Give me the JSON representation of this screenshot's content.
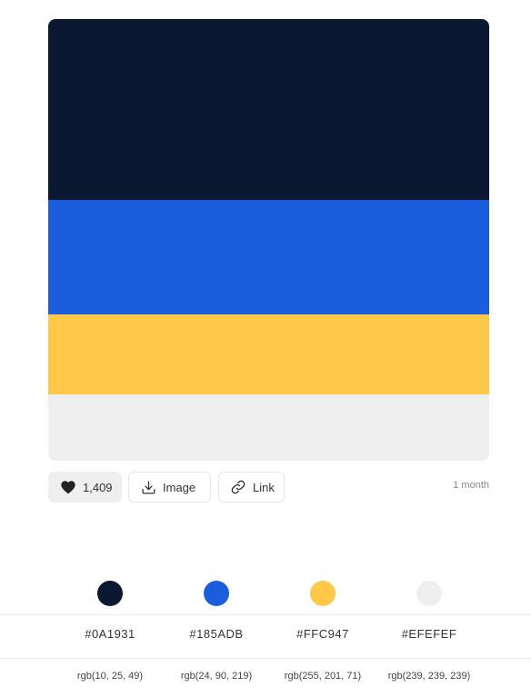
{
  "palette": {
    "colors": [
      {
        "hex": "#0A1931",
        "swatch": "#0A1931",
        "rgb": "rgb(10, 25, 49)"
      },
      {
        "hex": "#185ADB",
        "swatch": "#1B5EDD",
        "rgb": "rgb(24, 90, 219)"
      },
      {
        "hex": "#FFC947",
        "swatch": "#FFC947",
        "rgb": "rgb(255, 201, 71)"
      },
      {
        "hex": "#EFEFEF",
        "swatch": "#EFEFEF",
        "rgb": "rgb(239, 239, 239)"
      }
    ]
  },
  "actions": {
    "likes": "1,409",
    "image_label": "Image",
    "link_label": "Link",
    "age": "1 month"
  },
  "icons": {
    "like": "heart-icon",
    "image": "download-icon",
    "link": "link-icon"
  }
}
